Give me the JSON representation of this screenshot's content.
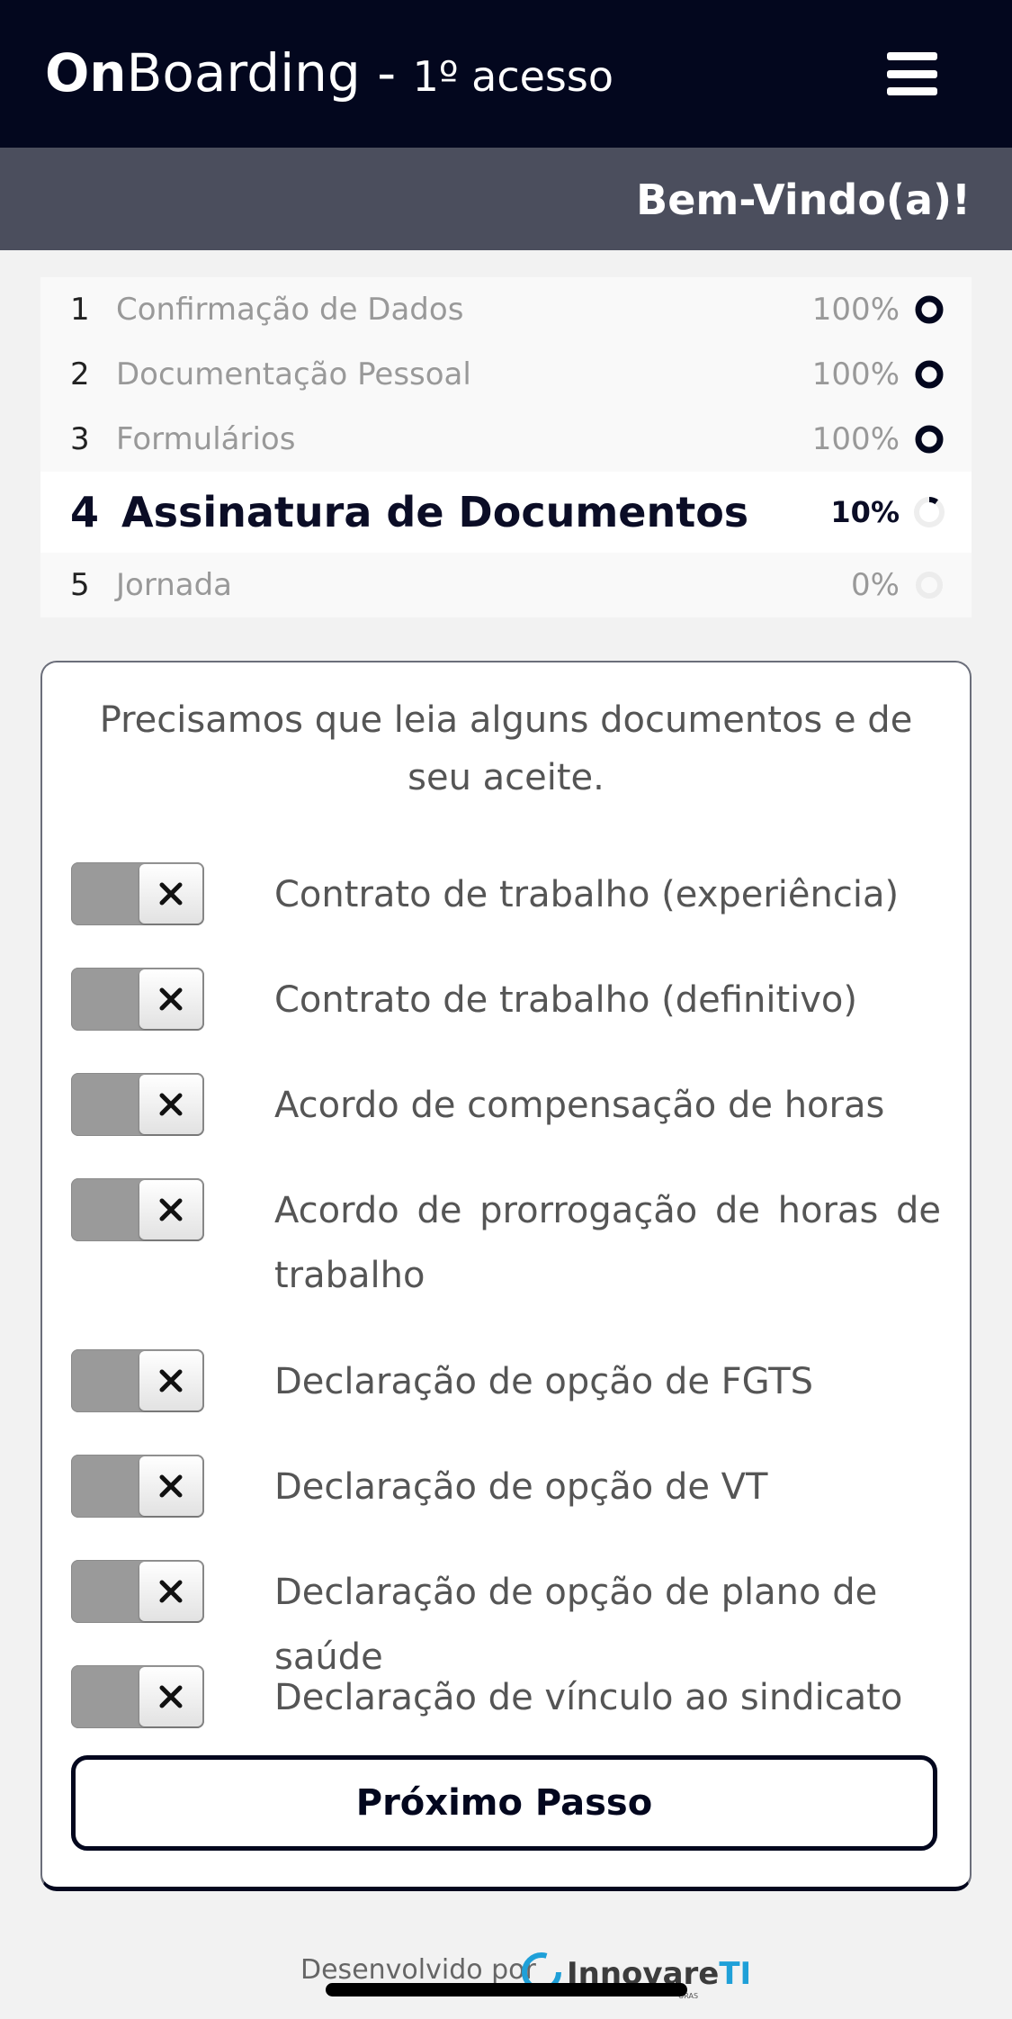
{
  "header": {
    "title_bold": "On",
    "title_rest": "Boarding - ",
    "title_sub": "1º acesso",
    "menu_icon": "hamburger-menu-icon",
    "background": "#03071e"
  },
  "subheader": {
    "welcome": "Bem-Vindo(a)!",
    "background": "#4b4e5d"
  },
  "steps": [
    {
      "num": "1",
      "label": "Confirmação de Dados",
      "percent": "100%",
      "progress": 1.0
    },
    {
      "num": "2",
      "label": "Documentação Pessoal",
      "percent": "100%",
      "progress": 1.0
    },
    {
      "num": "3",
      "label": "Formulários",
      "percent": "100%",
      "progress": 1.0
    },
    {
      "num": "4",
      "label": "Assinatura de Documentos",
      "percent": "10%",
      "progress": 0.1,
      "active": true
    },
    {
      "num": "5",
      "label": "Jornada",
      "percent": "0%",
      "progress": 0.0
    }
  ],
  "card": {
    "intro": "Precisamos que leia alguns documentos e de seu aceite.",
    "documents": [
      {
        "label": "Contrato de trabalho (experiência)",
        "accepted": false
      },
      {
        "label": "Contrato de trabalho (definitivo)",
        "accepted": false
      },
      {
        "label": "Acordo de compensação de horas",
        "accepted": false
      },
      {
        "label": "Acordo de prorrogação de horas de trabalho",
        "accepted": false
      },
      {
        "label": "Declaração de opção de FGTS",
        "accepted": false
      },
      {
        "label": "Declaração de opção de VT",
        "accepted": false
      },
      {
        "label": "Declaração de opção de plano de saúde",
        "accepted": false
      },
      {
        "label": "Declaração de vínculo ao sindicato",
        "accepted": false
      }
    ],
    "next_button": "Próximo Passo"
  },
  "footer": {
    "developed_by": "Desenvolvido por",
    "brand_main": "Innovare",
    "brand_accent": "TI",
    "brand_tag": "ORAS",
    "accent_color": "#1fa0d8"
  }
}
